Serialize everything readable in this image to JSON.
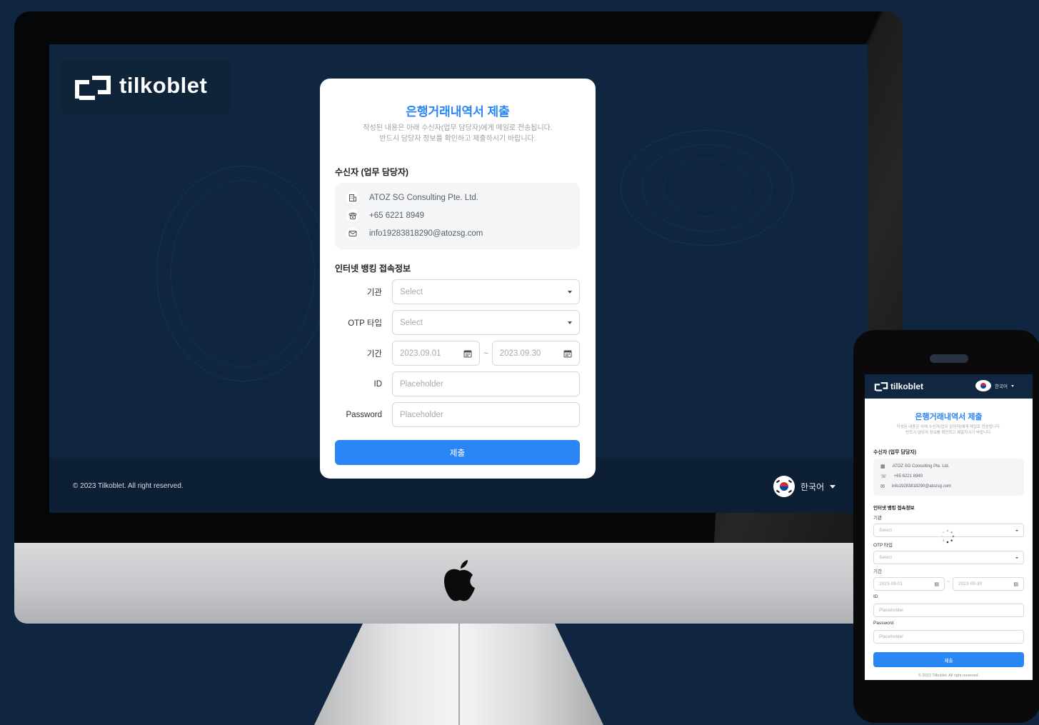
{
  "brand": {
    "name": "tilkoblet"
  },
  "desktop": {
    "card": {
      "title": "은행거래내역서 제출",
      "subtitle_line1": "작성된 내용은 아래 수신자(업무 담당자)에게 메일로 전송됩니다.",
      "subtitle_line2": "반드시 담당자 정보를 확인하고 제출하시기 바랍니다.",
      "recipient_heading": "수신자 (업무 담당자)",
      "recipient": {
        "company": "ATOZ SG Consulting Pte. Ltd.",
        "phone": "+65 6221 8949",
        "email": "info19283818290@atozsg.com"
      },
      "banking_heading": "인터넷 뱅킹 접속정보",
      "fields": {
        "institution": {
          "label": "기관",
          "value": "Select"
        },
        "otp": {
          "label": "OTP 타입",
          "value": "Select"
        },
        "period": {
          "label": "기간",
          "start": "2023.09.01",
          "separator": "~",
          "end": "2023.09.30"
        },
        "id": {
          "label": "ID",
          "placeholder": "Placeholder"
        },
        "password": {
          "label": "Password",
          "placeholder": "Placeholder"
        }
      },
      "submit_label": "제출"
    },
    "footer": {
      "copyright": "© 2023 Tilkoblet. All right reserved.",
      "language": "한국어"
    }
  },
  "mobile": {
    "header": {
      "brand": "tilkoblet",
      "language": "한국어"
    },
    "title": "은행거래내역서 제출",
    "subtitle_line1": "작성된 내용은 아래 수신자(업무 담당자)에게 메일로 전송됩니다.",
    "subtitle_line2": "반드시 담당자 정보를 확인하고 제출하시기 바랍니다.",
    "recipient_heading": "수신자 (업무 담당자)",
    "recipient": {
      "company": "ATOZ SG Consulting Pte. Ltd.",
      "phone": "+65 6221 8949",
      "email": "info19283818290@atozsg.com"
    },
    "banking_heading": "인터넷 뱅킹 접속정보",
    "fields": {
      "institution": {
        "label": "기관",
        "value": "Select"
      },
      "otp": {
        "label": "OTP 타입",
        "value": "Select"
      },
      "period": {
        "label": "기간",
        "start": "2023-09-01",
        "separator": "~",
        "end": "2023-09-30"
      },
      "id": {
        "label": "ID",
        "placeholder": "Placeholder"
      },
      "password": {
        "label": "Password",
        "placeholder": "Placeholder"
      }
    },
    "submit_label": "제출",
    "copyright": "© 2023 Tilkoblet. All right reserved."
  },
  "colors": {
    "accent": "#2a86f5",
    "background": "#102540",
    "card": "#ffffff"
  },
  "icons": [
    "building-icon",
    "phone-icon",
    "mail-icon",
    "calendar-icon",
    "chevron-down-icon",
    "korea-flag-icon",
    "apple-logo-icon",
    "loading-spinner-icon"
  ]
}
